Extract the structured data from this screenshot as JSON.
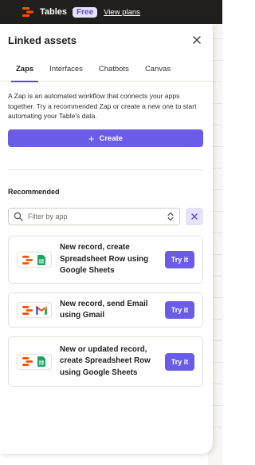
{
  "topbar": {
    "app_name": "Tables",
    "plan_badge": "Free",
    "view_plans": "View plans"
  },
  "panel": {
    "title": "Linked assets",
    "tabs": [
      {
        "label": "Zaps",
        "active": true
      },
      {
        "label": "Interfaces",
        "active": false
      },
      {
        "label": "Chatbots",
        "active": false
      },
      {
        "label": "Canvas",
        "active": false
      }
    ],
    "description": "A Zap is an automated workflow that connects your apps together. Try a recommended Zap or create a new one to start automating your Table's data.",
    "create_label": "Create",
    "recommended_title": "Recommended",
    "filter_placeholder": "Filter by app",
    "cards": [
      {
        "text": "New record, create Spreadsheet Row using Google Sheets",
        "apps": [
          "zapier-tables-icon",
          "google-sheets-icon"
        ],
        "action": "Try it"
      },
      {
        "text": "New record, send Email using Gmail",
        "apps": [
          "zapier-tables-icon",
          "gmail-icon"
        ],
        "action": "Try it"
      },
      {
        "text": "New or updated record, create Spreadsheet Row using Google Sheets",
        "apps": [
          "zapier-tables-icon",
          "google-sheets-icon"
        ],
        "action": "Try it"
      }
    ]
  },
  "colors": {
    "accent": "#6b5ce7",
    "topbar": "#211f1d",
    "brand_orange": "#ff4f00",
    "sheets_green": "#1fa463"
  }
}
